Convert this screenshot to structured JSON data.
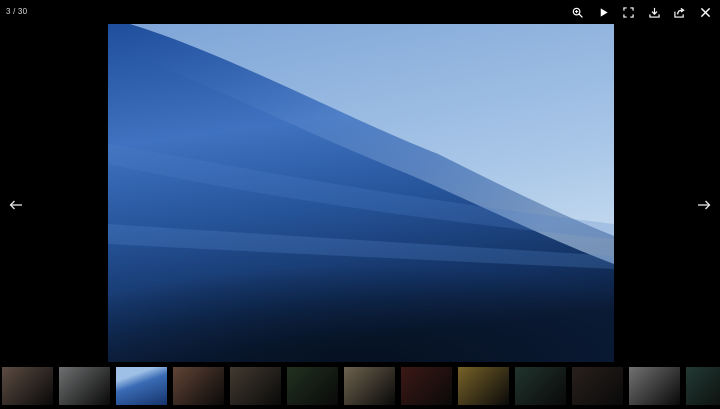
{
  "viewer": {
    "counter": "3 / 30",
    "current": 3,
    "total": 30
  },
  "toolbar": {
    "buttons": [
      {
        "name": "zoom-button",
        "icon": "zoom-in-icon"
      },
      {
        "name": "slideshow-play-button",
        "icon": "play-icon"
      },
      {
        "name": "fullscreen-button",
        "icon": "fullscreen-icon"
      },
      {
        "name": "download-button",
        "icon": "download-icon"
      },
      {
        "name": "share-button",
        "icon": "share-icon"
      },
      {
        "name": "close-button",
        "icon": "close-icon"
      }
    ]
  },
  "navigation": {
    "prev_icon": "arrow-left-icon",
    "next_icon": "arrow-right-icon"
  },
  "image": {
    "subject": "ocean-wave",
    "palette": {
      "sky_top": "#7fa6d8",
      "sky_bottom": "#c7dbef",
      "wave_light": "#3d72c2",
      "wave_dark": "#0b1d3a"
    }
  },
  "thumbnails": {
    "active_index": 2,
    "items": [
      {
        "subject": "flowers-portrait",
        "color": "#a88a79"
      },
      {
        "subject": "white-flower",
        "color": "#c9cccd"
      },
      {
        "subject": "ocean-wave",
        "color": "#3a6bb5"
      },
      {
        "subject": "woman-scarf",
        "color": "#b07c62"
      },
      {
        "subject": "deer-room",
        "color": "#7a6a58"
      },
      {
        "subject": "palm-hat",
        "color": "#3d5a3a"
      },
      {
        "subject": "beach-sand",
        "color": "#c6b38f"
      },
      {
        "subject": "red-car",
        "color": "#6e2e28"
      },
      {
        "subject": "woman-yellow",
        "color": "#d9b24a"
      },
      {
        "subject": "palm-leaves",
        "color": "#3d5f52"
      },
      {
        "subject": "hands-coffee",
        "color": "#4a3b34"
      },
      {
        "subject": "white-curtain",
        "color": "#cfcfcf"
      },
      {
        "subject": "green-leaves",
        "color": "#3f6a5e"
      }
    ]
  }
}
